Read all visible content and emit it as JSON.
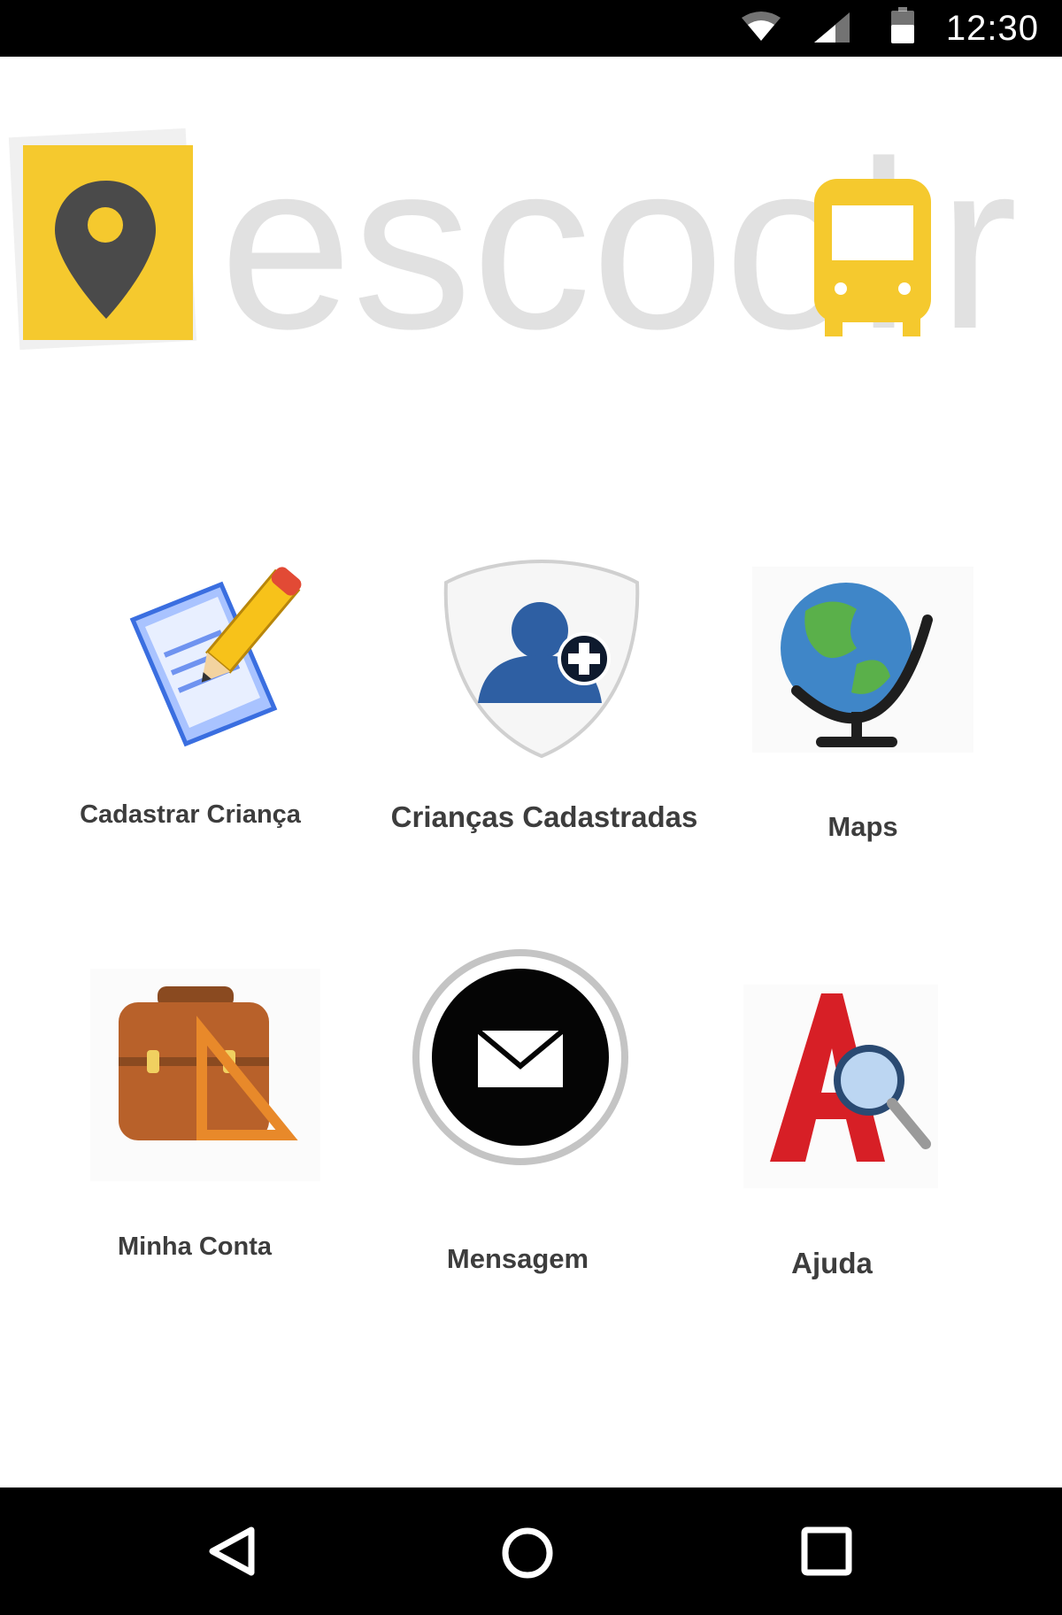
{
  "status_bar": {
    "time": "12:30",
    "icons": [
      "wifi-icon",
      "cellular-signal-icon",
      "battery-icon"
    ]
  },
  "logo": {
    "text_left": "escool",
    "text_right": "r",
    "icons": [
      "map-pin-icon",
      "school-bus-icon"
    ],
    "accent_color": "#f5c92e",
    "text_color": "#e1e1e1",
    "pin_color": "#4a4a4a"
  },
  "menu": {
    "items": [
      {
        "label": "Cadastrar Criança",
        "icon": "document-pencil-icon"
      },
      {
        "label": "Crianças Cadastradas",
        "icon": "add-user-shield-icon"
      },
      {
        "label": "Maps",
        "icon": "globe-icon"
      },
      {
        "label": "Minha Conta",
        "icon": "briefcase-ruler-icon"
      },
      {
        "label": "Mensagem",
        "icon": "envelope-icon"
      },
      {
        "label": "Ajuda",
        "icon": "letter-a-magnifier-icon"
      }
    ]
  },
  "nav_bar": {
    "buttons": [
      "back-icon",
      "home-icon",
      "recents-icon"
    ]
  }
}
